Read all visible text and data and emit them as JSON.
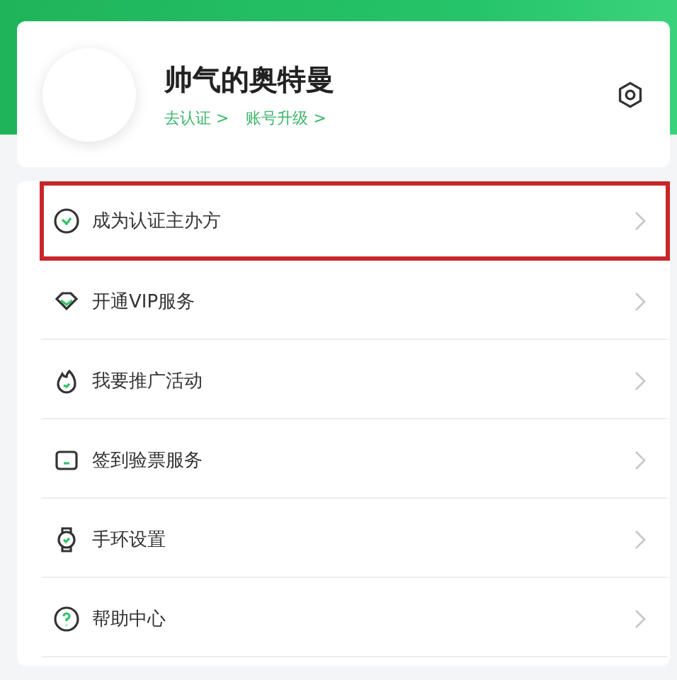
{
  "profile": {
    "name": "帅气的奥特曼",
    "links": [
      "去认证 >",
      "账号升级 >"
    ]
  },
  "menu": [
    {
      "kind": "verify",
      "label": "成为认证主办方",
      "highlighted": true
    },
    {
      "kind": "diamond",
      "label": "开通VIP服务",
      "highlighted": false
    },
    {
      "kind": "flame",
      "label": "我要推广活动",
      "highlighted": false
    },
    {
      "kind": "ticket",
      "label": "签到验票服务",
      "highlighted": false
    },
    {
      "kind": "watch",
      "label": "手环设置",
      "highlighted": false
    },
    {
      "kind": "help",
      "label": "帮助中心",
      "highlighted": false
    }
  ]
}
